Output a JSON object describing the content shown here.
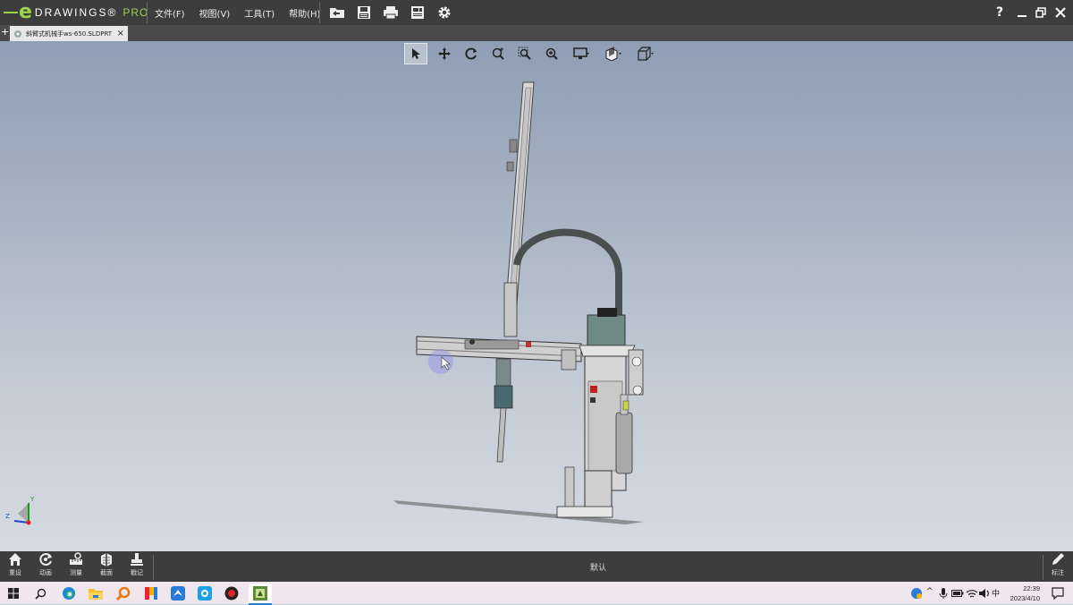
{
  "app": {
    "logo_letter": "e",
    "logo_brand": "DRAWINGS®",
    "logo_pro": "PRO"
  },
  "menu": [
    "文件(F)",
    "视图(V)",
    "工具(T)",
    "帮助(H)"
  ],
  "toolbar_icons": [
    "open-folder-icon",
    "save-icon",
    "print-icon",
    "sheet-icon",
    "gear-icon"
  ],
  "window_controls": {
    "help": "?"
  },
  "tab": {
    "title": "斜臂式机械手ws-650.SLDPRT",
    "add": "+",
    "close": "×"
  },
  "hud_tools": [
    "select-arrow-icon",
    "pan-icon",
    "rotate-icon",
    "zoom-fit-icon",
    "zoom-area-icon",
    "zoom-icon",
    "display-style-icon",
    "section-icon",
    "view-orientation-icon"
  ],
  "bottom_buttons": [
    {
      "label": "重设",
      "icon": "home-icon"
    },
    {
      "label": "动画",
      "icon": "animate-icon"
    },
    {
      "label": "测量",
      "icon": "measure-icon"
    },
    {
      "label": "截面",
      "icon": "section-view-icon"
    },
    {
      "label": "戳记",
      "icon": "stamp-icon"
    }
  ],
  "configuration": "默认",
  "markup": {
    "label": "标注"
  },
  "triad": {
    "y": "Y",
    "z": "Z"
  },
  "taskbar": {
    "ime": "中",
    "time": "22:39",
    "date": "2023/4/10"
  },
  "colors": {
    "accent": "#9bd34a",
    "titlebar": "#3d3d3d"
  }
}
